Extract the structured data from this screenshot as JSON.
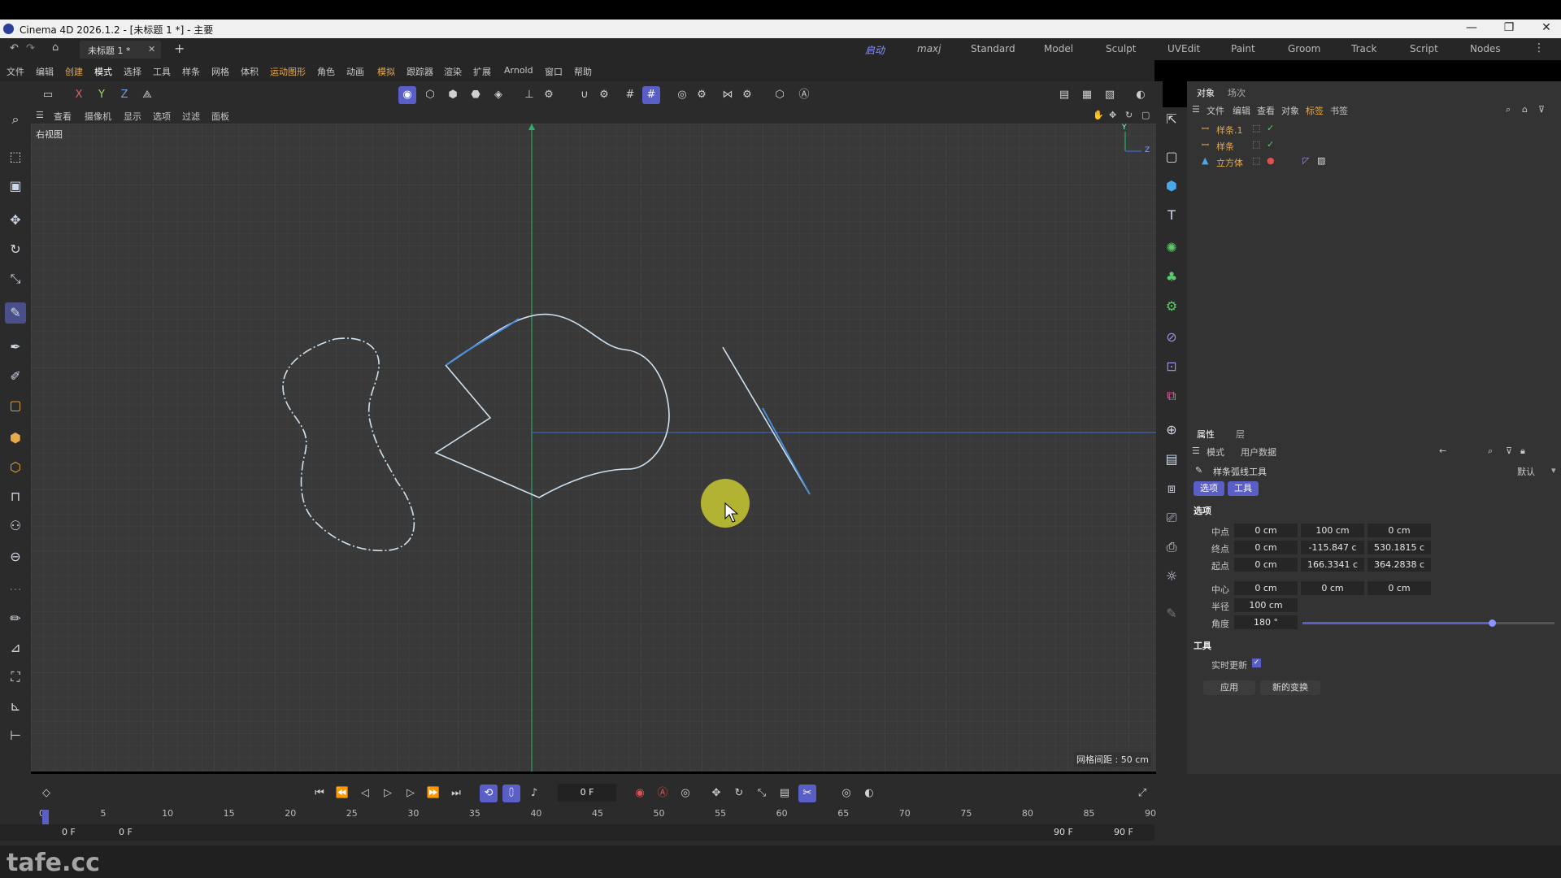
{
  "window": {
    "title": "Cinema 4D 2026.1.2 - [未标题 1 *] - 主要",
    "min": "—",
    "max": "❐",
    "close": "✕"
  },
  "tabs": {
    "document": "未标题 1 *",
    "close": "✕",
    "add": "+"
  },
  "layouts": [
    "启动",
    "maxj",
    "Standard",
    "Model",
    "Sculpt",
    "UVEdit",
    "Paint",
    "Groom",
    "Track",
    "Script",
    "Nodes"
  ],
  "menu": [
    "文件",
    "编辑",
    "创建",
    "模式",
    "选择",
    "工具",
    "样条",
    "网格",
    "体积",
    "运动图形",
    "角色",
    "动画",
    "模拟",
    "跟踪器",
    "渲染",
    "扩展",
    "Arnold",
    "窗口",
    "帮助"
  ],
  "toolbar": {
    "x": "X",
    "y": "Y",
    "z": "Z"
  },
  "viewport": {
    "menu": [
      "查看",
      "摄像机",
      "显示",
      "选项",
      "过滤",
      "面板"
    ],
    "label": "右视图",
    "grid_info": "网格间距 : 50 cm",
    "axis_y": "Y",
    "axis_z": "Z"
  },
  "objects": {
    "tabs": [
      "对象",
      "场次"
    ],
    "menu": [
      "文件",
      "编辑",
      "查看",
      "对象",
      "标签",
      "书签"
    ],
    "items": [
      {
        "name": "样条.1"
      },
      {
        "name": "样条"
      },
      {
        "name": "立方体"
      }
    ]
  },
  "attributes": {
    "tabs": [
      "属性",
      "层"
    ],
    "menu": [
      "模式",
      "用户数据"
    ],
    "tool_name": "样条弧线工具",
    "preset": "默认",
    "subtabs": [
      "选项",
      "工具"
    ],
    "section_options": "选项",
    "rows": [
      {
        "label": "中点",
        "values": [
          "0 cm",
          "100 cm",
          "0 cm"
        ]
      },
      {
        "label": "终点",
        "values": [
          "0 cm",
          "-115.847 c",
          "530.1815 c"
        ]
      },
      {
        "label": "起点",
        "values": [
          "0 cm",
          "166.3341 c",
          "364.2838 c"
        ]
      },
      {
        "label": "中心",
        "values": [
          "0 cm",
          "0 cm",
          "0 cm"
        ]
      }
    ],
    "radius_label": "半径",
    "radius": "100 cm",
    "angle_label": "角度",
    "angle": "180 °",
    "angle_slider_fraction": 0.75,
    "section_tool": "工具",
    "realtime_label": "实时更新",
    "apply": "应用",
    "new_transform": "新的变换"
  },
  "timeline": {
    "current_frame": "0 F",
    "ticks": [
      "0",
      "5",
      "10",
      "15",
      "20",
      "25",
      "30",
      "35",
      "40",
      "45",
      "50",
      "55",
      "60",
      "65",
      "70",
      "75",
      "80",
      "85",
      "90"
    ],
    "start": "0 F",
    "start2": "0 F",
    "end": "90 F",
    "end2": "90 F"
  },
  "watermark": "tafe.cc",
  "colors": {
    "accent": "#8c94ff",
    "select": "#5a5fc8",
    "object_name": "#e8a94a",
    "cursor": "#c8c832"
  }
}
